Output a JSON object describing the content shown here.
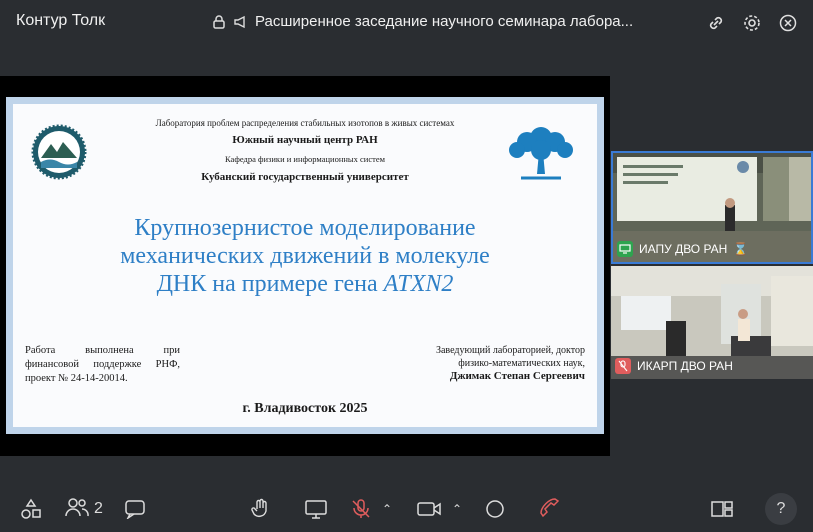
{
  "app": {
    "title": "Контур Толк"
  },
  "meeting": {
    "title": "Расширенное заседание научного семинара лабора..."
  },
  "slide": {
    "lab_line": "Лаборатория проблем распределения стабильных изотопов в живых системах",
    "south_center": "Южный научный центр РАН",
    "department": "Кафедра физики и информационных систем",
    "university": "Кубанский государственный университет",
    "title_line1": "Крупнозернистое моделирование",
    "title_line2": "механических движений в молекуле",
    "title_line3": "ДНК на примере гена ",
    "title_gene": "ATXN2",
    "funding": "Работа выполнена при финансовой поддержке РНФ, проект № 24-14-20014.",
    "head_line1": "Заведующий лабораторией, доктор",
    "head_line2": "физико-математических наук,",
    "head_name": "Джимак Степан Сергеевич",
    "city": "г. Владивосток 2025"
  },
  "participants": [
    {
      "name": "ИАПУ ДВО РАН",
      "status": "active-speaker"
    },
    {
      "name": "ИКАРП ДВО РАН",
      "status": "muted"
    }
  ],
  "toolbar": {
    "participants_count": "2",
    "help": "?"
  },
  "colors": {
    "accent": "#3a7bd5",
    "mic_off": "#e05d5d",
    "slide_title": "#2e7fc6"
  }
}
